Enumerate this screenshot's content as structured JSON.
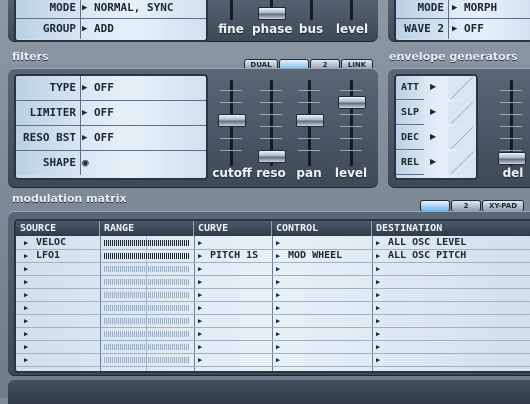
{
  "osc_panel": {
    "rows": [
      {
        "label": "MODE",
        "value": "NORMAL, SYNC"
      },
      {
        "label": "GROUP",
        "value": "ADD"
      }
    ]
  },
  "osc_faders": {
    "labels": [
      "fine",
      "phase",
      "bus",
      "level"
    ]
  },
  "osc2_panel": {
    "rows": [
      {
        "label": "MODE",
        "value": "MORPH"
      },
      {
        "label": "WAVE 2",
        "value": "OFF"
      }
    ]
  },
  "filters": {
    "title": "filters",
    "tabs": [
      "DUAL",
      "",
      "2",
      "LINK"
    ],
    "rows": [
      {
        "label": "TYPE",
        "value": "OFF"
      },
      {
        "label": "LIMITER",
        "value": "OFF"
      },
      {
        "label": "RESO BST",
        "value": "OFF"
      },
      {
        "label": "SHAPE",
        "value": ""
      }
    ],
    "fader_labels": [
      "cutoff",
      "reso",
      "pan",
      "level"
    ]
  },
  "envelope": {
    "title": "envelope generators",
    "buttons": [
      "ATT",
      "SLP",
      "DEC",
      "REL"
    ],
    "fader_label": "del"
  },
  "mod_matrix": {
    "title": "modulation matrix",
    "tabs": [
      "",
      "2",
      "XY-PAD"
    ],
    "headers": [
      "SOURCE",
      "RANGE",
      "CURVE",
      "CONTROL",
      "DESTINATION"
    ],
    "rows": [
      {
        "source": "VELOC",
        "curve": "",
        "control": "",
        "destination": "ALL OSC LEVEL",
        "active": true
      },
      {
        "source": "LFO1",
        "curve": "PITCH 1S",
        "control": "MOD WHEEL",
        "destination": "ALL OSC PITCH",
        "active": true
      },
      {
        "source": "",
        "curve": "",
        "control": "",
        "destination": "",
        "active": false
      },
      {
        "source": "",
        "curve": "",
        "control": "",
        "destination": "",
        "active": false
      },
      {
        "source": "",
        "curve": "",
        "control": "",
        "destination": "",
        "active": false
      },
      {
        "source": "",
        "curve": "",
        "control": "",
        "destination": "",
        "active": false
      },
      {
        "source": "",
        "curve": "",
        "control": "",
        "destination": "",
        "active": false
      },
      {
        "source": "",
        "curve": "",
        "control": "",
        "destination": "",
        "active": false
      },
      {
        "source": "",
        "curve": "",
        "control": "",
        "destination": "",
        "active": false
      },
      {
        "source": "",
        "curve": "",
        "control": "",
        "destination": "",
        "active": false
      }
    ]
  },
  "icons": {
    "arrow": "triangle-right-icon",
    "shape": "eye-icon"
  }
}
